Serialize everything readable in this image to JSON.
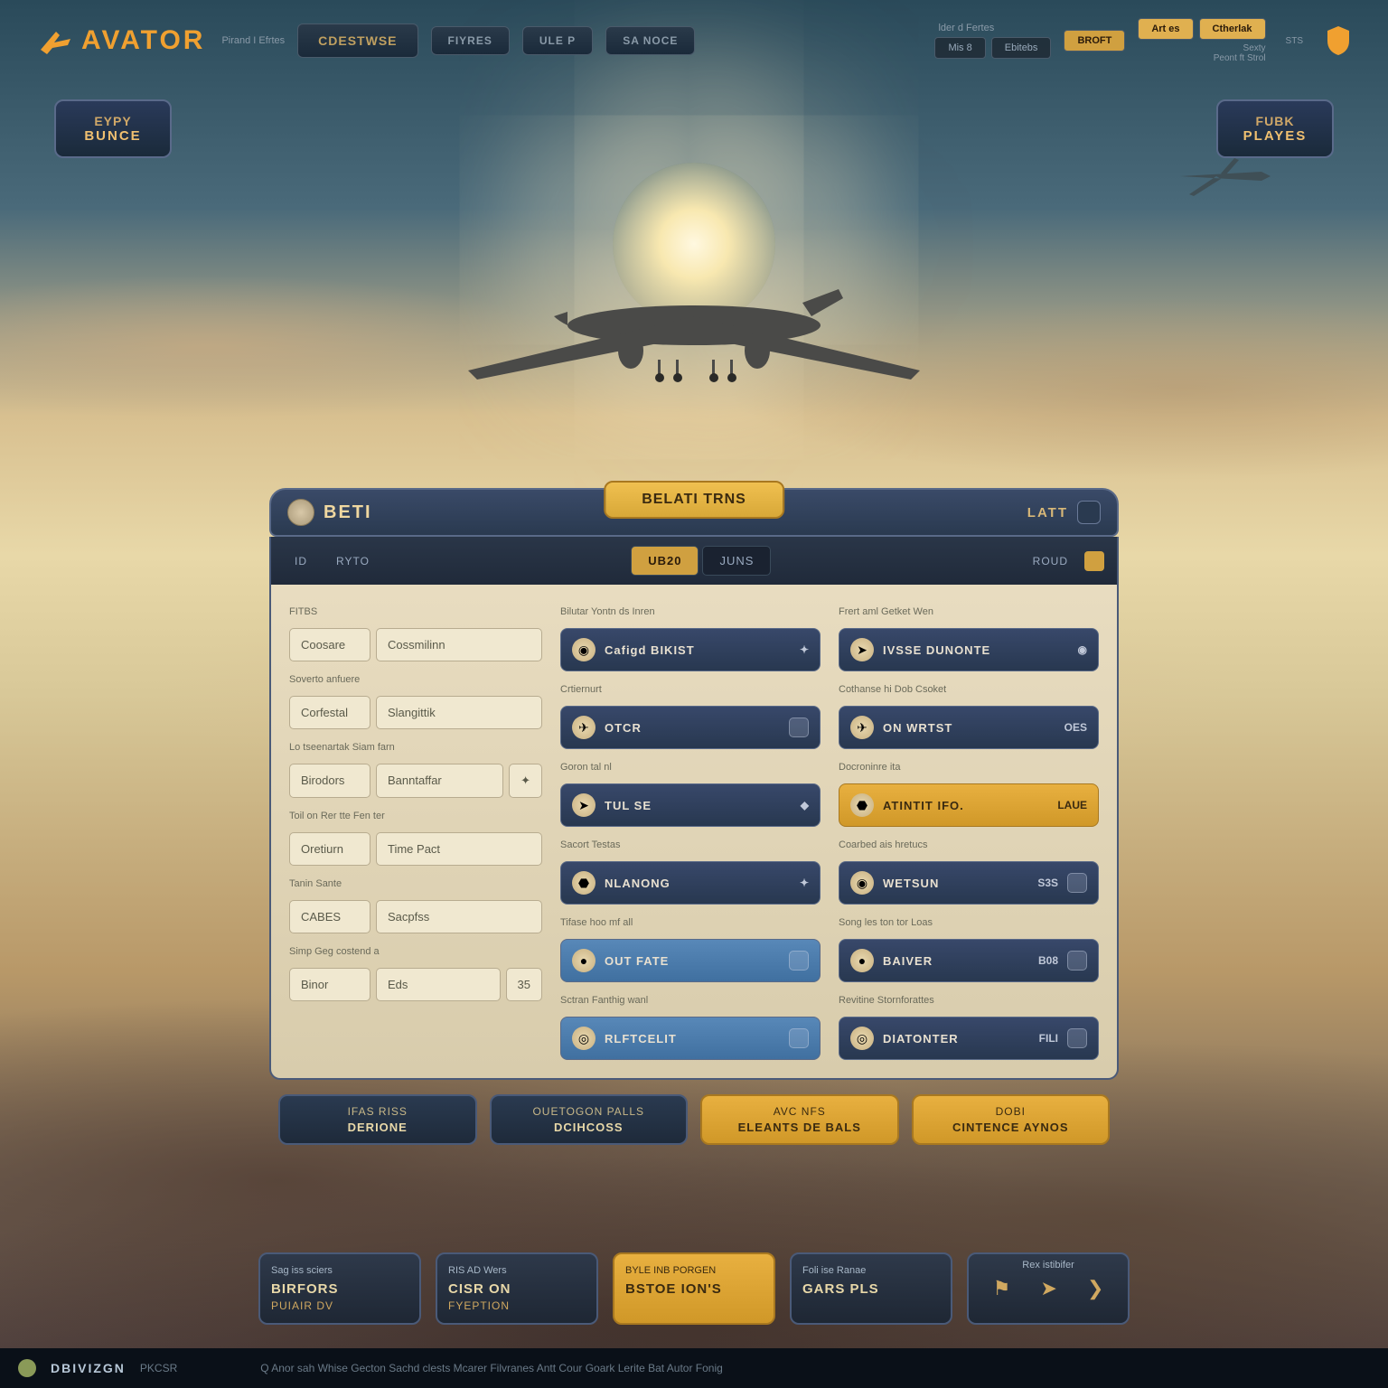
{
  "header": {
    "brand": "AVATOR",
    "sub": "Pirand I Efrtes",
    "nav1": "CDESTWSE",
    "nav2": "FIYRES",
    "nav3": "ULE P",
    "nav4": "SA NOCE",
    "topMeta1": "lder d Fertes",
    "pill1": "Mis 8",
    "pill2": "Ebitebs",
    "pill3": "BROFT",
    "pill4": "Art es",
    "pill5": "Ctherlak",
    "meta2a": "Sexty",
    "meta2b": "Peont ft Strol",
    "sts": "STS"
  },
  "hero": {
    "left1": "EYPY",
    "left2": "BUNCE",
    "right1": "FUBK",
    "right2": "PLAYES"
  },
  "panel": {
    "topLeft": "BETI",
    "topCenter": "BELATI TRNS",
    "topRight": "LATT",
    "tabs": {
      "id": "ID",
      "t1": "RYTO",
      "mid1": "UB20",
      "mid2": "JUNS",
      "end": "ROUD"
    }
  },
  "colA": {
    "s1": "FITBS",
    "r1a": "Coosare",
    "r1b": "Cossmilinn",
    "s2": "Soverto anfuere",
    "r2a": "Corfestal",
    "r2b": "Slangittik",
    "s3": "Lo tseenartak Siam farn",
    "r3a": "Birodors",
    "r3b": "Banntaffar",
    "s4": "Toil on Rer tte Fen ter",
    "r4a": "Oretiurn",
    "r4b": "Time Pact",
    "s5": "Tanin Sante",
    "r5a": "CABES",
    "r5b": "Sacpfss",
    "s6": "Simp Geg costend a",
    "r6a": "Binor",
    "r6b": "Eds",
    "r6c": "35"
  },
  "colB": {
    "s1": "Bilutar Yontn ds Inren",
    "r1": "Cafigd BIKIST",
    "s2": "Crtiernurt",
    "r2": "OTCR",
    "s3": "Goron tal nl",
    "r3": "TUL SE",
    "s4": "Sacort Testas",
    "r4": "NLANONG",
    "s5": "Tifase hoo mf all",
    "r5": "OUT FATE",
    "s6": "Sctran Fanthig wanl",
    "r6": "RLFTCELIT"
  },
  "colC": {
    "s1": "Frert aml Getket Wen",
    "r1": "IVSSE DUNONTE",
    "s2": "Cothanse hi Dob Csoket",
    "r2": "ON WRTST",
    "r2e": "OES",
    "s3": "Docroninre ita",
    "r3": "ATINTIT IFO.",
    "r3e": "LAUE",
    "s4": "Coarbed ais hretucs",
    "r4": "WETSUN",
    "r4e": "S3S",
    "s5": "Song les ton tor Loas",
    "r5": "BAIVER",
    "r5e": "B08",
    "s6": "Revitine Stornforattes",
    "r6": "DIATONTER",
    "r6e": "FILI"
  },
  "foot": {
    "b1a": "IFAS RISS",
    "b1b": "DERIONE",
    "b2a": "OUETOGON PALLS",
    "b2b": "DCIHCOSS",
    "b3a": "AVC NFS",
    "b3b": "ELEANTS DE BALS",
    "b4a": "DOBI",
    "b4b": "CINTENCE AYNOS"
  },
  "cards": {
    "c1a": "Sag iss sciers",
    "c1b": "BIRFORS",
    "c1c": "PUIAIR DV",
    "c2a": "RIS AD Wers",
    "c2b": "CISR ON",
    "c2c": "FYEPTION",
    "c3a": "BYLE INB PORGEN",
    "c3b": "BSTOE ION'S",
    "c4a": "Foli ise Ranae",
    "c4b": "GARS PLS",
    "c5a": "Rex istibifer"
  },
  "footer": {
    "brand": "DBIVIZGN",
    "t1": "PKCSR",
    "items": "Q Anor sah  Whise Gecton  Sachd clests  Mcarer  Filvranes  Antt  Cour  Goark  Lerite  Bat Autor Fonig"
  }
}
